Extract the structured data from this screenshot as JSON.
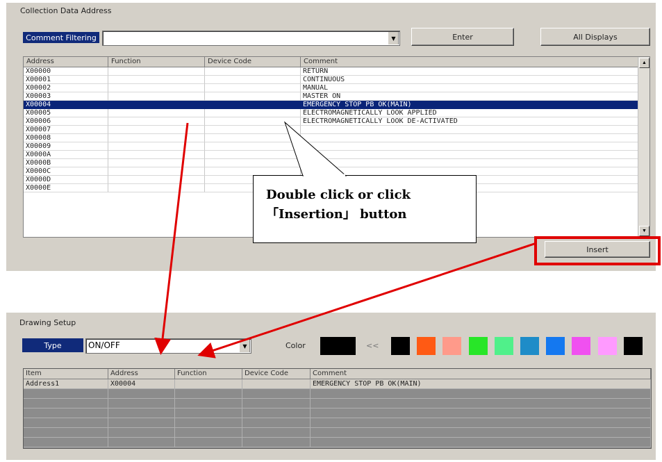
{
  "top": {
    "group_title": "Collection Data Address",
    "filter_label": "Comment Filtering",
    "filter_value": "",
    "enter_button": "Enter",
    "all_displays_button": "All Displays",
    "columns": [
      "Address",
      "Function",
      "Device Code",
      "Comment"
    ],
    "rows": [
      {
        "address": "X00000",
        "function": "",
        "device": "",
        "comment": "RETURN"
      },
      {
        "address": "X00001",
        "function": "",
        "device": "",
        "comment": "CONTINUOUS"
      },
      {
        "address": "X00002",
        "function": "",
        "device": "",
        "comment": "MANUAL"
      },
      {
        "address": "X00003",
        "function": "",
        "device": "",
        "comment": "MASTER ON"
      },
      {
        "address": "X00004",
        "function": "",
        "device": "",
        "comment": "EMERGENCY STOP PB OK(MAIN)"
      },
      {
        "address": "X00005",
        "function": "",
        "device": "",
        "comment": "ELECTROMAGNETICALLY LOOK APPLIED"
      },
      {
        "address": "X00006",
        "function": "",
        "device": "",
        "comment": "ELECTROMAGNETICALLY LOOK DE-ACTIVATED"
      },
      {
        "address": "X00007",
        "function": "",
        "device": "",
        "comment": ""
      },
      {
        "address": "X00008",
        "function": "",
        "device": "",
        "comment": ""
      },
      {
        "address": "X00009",
        "function": "",
        "device": "",
        "comment": ""
      },
      {
        "address": "X0000A",
        "function": "",
        "device": "",
        "comment": ""
      },
      {
        "address": "X0000B",
        "function": "",
        "device": "",
        "comment": ""
      },
      {
        "address": "X0000C",
        "function": "",
        "device": "",
        "comment": ""
      },
      {
        "address": "X0000D",
        "function": "",
        "device": "",
        "comment": ""
      },
      {
        "address": "X0000E",
        "function": "",
        "device": "",
        "comment": ""
      }
    ],
    "selected_row_index": 4,
    "insert_button": "Insert"
  },
  "callout": {
    "line1": "Double click or click",
    "line2": "「Insertion」 button"
  },
  "bottom": {
    "group_title": "Drawing Setup",
    "type_label": "Type",
    "type_value": "ON/OFF",
    "color_label": "Color",
    "arrows_label": "<<",
    "selected_color": "#000000",
    "palette": [
      "#000000",
      "#ff5a14",
      "#ff9a8a",
      "#28e628",
      "#50f08a",
      "#1e8cc8",
      "#1478f0",
      "#f050f0",
      "#ff9aff",
      "#000000"
    ],
    "columns": [
      "Item",
      "Address",
      "Function",
      "Device Code",
      "Comment"
    ],
    "rows": [
      {
        "item": "Address1",
        "address": "X00004",
        "function": "",
        "device": "",
        "comment": "EMERGENCY STOP PB OK(MAIN)"
      }
    ]
  },
  "annotation_color": "#e00000"
}
